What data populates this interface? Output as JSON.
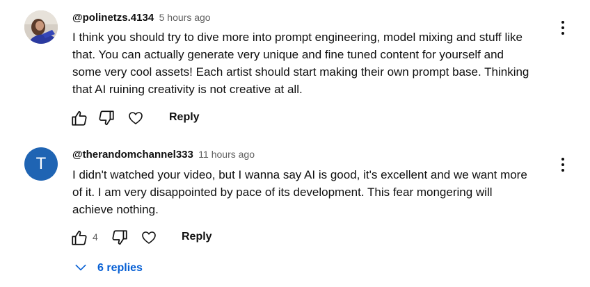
{
  "comments": [
    {
      "author": "@polinetzs.4134",
      "time": "5 hours ago",
      "avatar_type": "photo",
      "lines": [
        "I think you should try to dive more into prompt engineering, model mixing and stuff like",
        "that. You can actually generate very unique and fine tuned content for yourself and",
        "some very cool assets! Each artist should start making their own prompt base. Thinking",
        "that AI ruining creativity is not creative at all."
      ],
      "like_count": "",
      "reply_label": "Reply"
    },
    {
      "author": "@therandomchannel333",
      "time": "11 hours ago",
      "avatar_letter": "T",
      "avatar_color": "#1f64b3",
      "lines": [
        "I didn't watched your video, but I wanna say AI is good, it's excellent and we want more",
        "of it. I am very disappointed by pace of its development. This fear mongering will",
        "achieve nothing."
      ],
      "like_count": "4",
      "reply_label": "Reply",
      "replies_label": "6 replies"
    }
  ],
  "icons": {
    "like": "thumbs-up-icon",
    "dislike": "thumbs-down-icon",
    "heart": "heart-icon",
    "menu": "kebab-menu-icon",
    "expand": "chevron-down-icon"
  },
  "colors": {
    "link_blue": "#065fd4",
    "secondary_text": "#606060"
  }
}
